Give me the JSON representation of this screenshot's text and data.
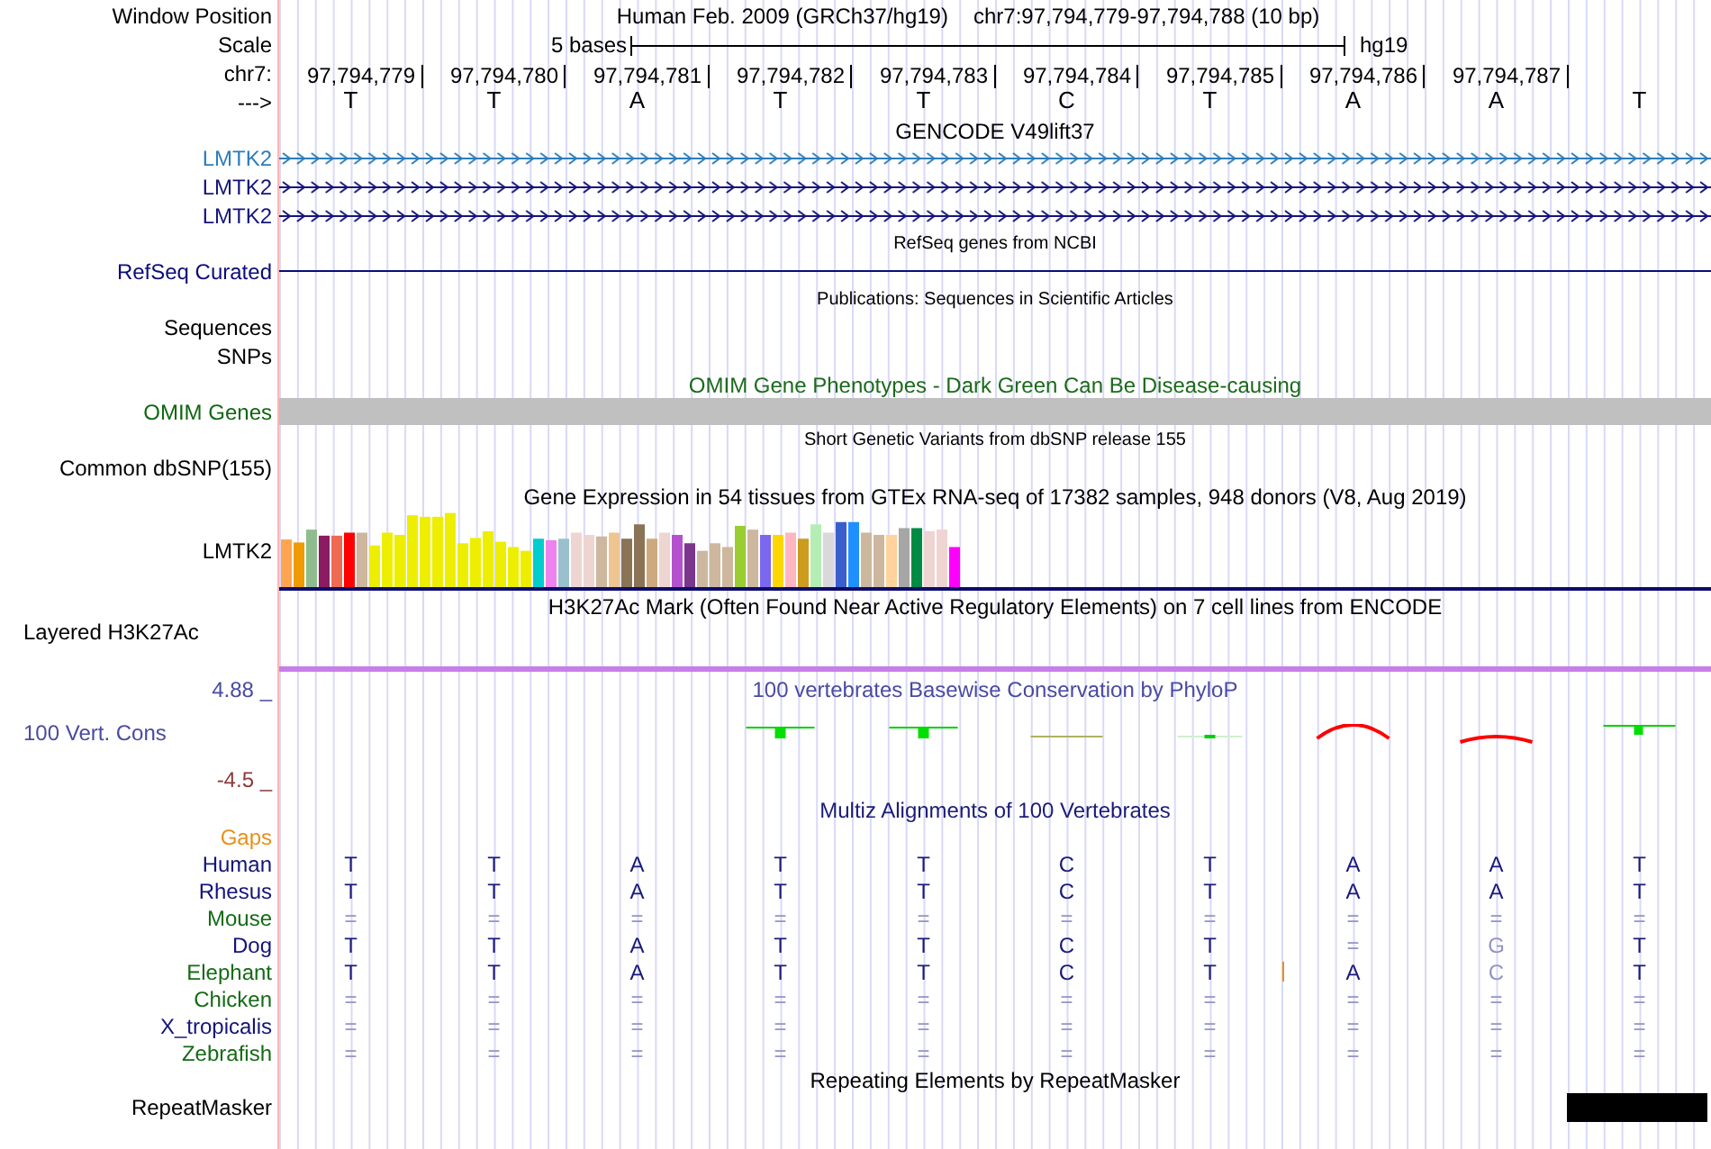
{
  "header": {
    "label": "Window Position",
    "title": "Human Feb. 2009 (GRCh37/hg19)",
    "position": "chr7:97,794,779-97,794,788 (10 bp)"
  },
  "scale": {
    "label": "Scale",
    "span": "5 bases",
    "assembly": "hg19"
  },
  "ruler": {
    "label": "chr7:",
    "positions": [
      "97,794,779",
      "97,794,780",
      "97,794,781",
      "97,794,782",
      "97,794,783",
      "97,794,784",
      "97,794,785",
      "97,794,786",
      "97,794,787"
    ]
  },
  "strand": {
    "label": "--->",
    "bases": [
      "T",
      "T",
      "A",
      "T",
      "T",
      "C",
      "T",
      "A",
      "A",
      "T"
    ]
  },
  "tracks": [
    {
      "kind": "title",
      "text": "GENCODE V49lift37",
      "color": "#000000"
    },
    {
      "kind": "gene",
      "label": "LMTK2",
      "color": "#2c7dbd"
    },
    {
      "kind": "gene",
      "label": "LMTK2",
      "color": "#14147a"
    },
    {
      "kind": "gene",
      "label": "LMTK2",
      "color": "#14147a"
    },
    {
      "kind": "small_title",
      "text": "RefSeq genes from NCBI",
      "color": "#000000"
    },
    {
      "kind": "line",
      "label": "RefSeq Curated",
      "color": "#0c0c78"
    },
    {
      "kind": "small_title",
      "text": "Publications: Sequences in Scientific Articles",
      "color": "#000000"
    },
    {
      "kind": "empty",
      "label": "Sequences",
      "color": "#000000"
    },
    {
      "kind": "empty",
      "label": "SNPs",
      "color": "#000000"
    },
    {
      "kind": "title",
      "text": "OMIM Gene Phenotypes - Dark Green Can Be Disease-causing",
      "color": "#1b6a1b"
    },
    {
      "kind": "bar",
      "label": "OMIM Genes",
      "color": "#0f660f"
    },
    {
      "kind": "small_title",
      "text": "Short Genetic Variants from dbSNP release 155",
      "color": "#000000"
    },
    {
      "kind": "empty",
      "label": "Common dbSNP(155)",
      "color": "#000000"
    },
    {
      "kind": "title",
      "text": "Gene Expression in 54 tissues from GTEx RNA-seq of 17382 samples, 948 donors (V8, Aug 2019)",
      "color": "#000000"
    },
    {
      "kind": "expression",
      "label": "LMTK2",
      "color": "#000000"
    },
    {
      "kind": "title",
      "text": "H3K27Ac Mark (Often Found Near Active Regulatory Elements) on 7 cell lines from ENCODE",
      "color": "#000000"
    },
    {
      "kind": "layered",
      "label": "Layered H3K27Ac",
      "color": "#000000"
    },
    {
      "kind": "conservation",
      "title": "100 vertebrates Basewise Conservation by PhyloP",
      "label": "100 Vert. Cons",
      "max": "4.88 _",
      "min": "-4.5 _",
      "color": "#4a4aa0"
    },
    {
      "kind": "title",
      "text": "Multiz Alignments of 100 Vertebrates",
      "color": "#1b1b78"
    },
    {
      "kind": "alignment",
      "rows": [
        {
          "label": "Gaps",
          "color": "#e8901c"
        },
        {
          "label": "Human",
          "color": "#14147a",
          "bases": [
            "T",
            "T",
            "A",
            "T",
            "T",
            "C",
            "T",
            "A",
            "A",
            "T"
          ],
          "faded": [
            false,
            false,
            false,
            false,
            false,
            false,
            false,
            false,
            false,
            false
          ],
          "insertion": false
        },
        {
          "label": "Rhesus",
          "color": "#14147a",
          "bases": [
            "T",
            "T",
            "A",
            "T",
            "T",
            "C",
            "T",
            "A",
            "A",
            "T"
          ],
          "faded": [
            false,
            false,
            false,
            false,
            false,
            false,
            false,
            false,
            false,
            false
          ],
          "insertion": false
        },
        {
          "label": "Mouse",
          "color": "#156b15",
          "bases": [
            "=",
            "=",
            "=",
            "=",
            "=",
            "=",
            "=",
            "=",
            "=",
            "="
          ],
          "faded": [
            true,
            true,
            true,
            true,
            true,
            true,
            true,
            true,
            true,
            true
          ],
          "insertion": false
        },
        {
          "label": "Dog",
          "color": "#14147a",
          "bases": [
            "T",
            "T",
            "A",
            "T",
            "T",
            "C",
            "T",
            "=",
            "G",
            "T"
          ],
          "faded": [
            false,
            false,
            false,
            false,
            false,
            false,
            false,
            true,
            true,
            false
          ],
          "insertion": false
        },
        {
          "label": "Elephant",
          "color": "#156b15",
          "bases": [
            "T",
            "T",
            "A",
            "T",
            "T",
            "C",
            "T",
            "A",
            "C",
            "T"
          ],
          "faded": [
            false,
            false,
            false,
            false,
            false,
            false,
            false,
            false,
            true,
            false
          ],
          "insertion": true
        },
        {
          "label": "Chicken",
          "color": "#156b15",
          "bases": [
            "=",
            "=",
            "=",
            "=",
            "=",
            "=",
            "=",
            "=",
            "=",
            "="
          ],
          "faded": [
            true,
            true,
            true,
            true,
            true,
            true,
            true,
            true,
            true,
            true
          ],
          "insertion": false
        },
        {
          "label": "X_tropicalis",
          "color": "#14147a",
          "bases": [
            "=",
            "=",
            "=",
            "=",
            "=",
            "=",
            "=",
            "=",
            "=",
            "="
          ],
          "faded": [
            true,
            true,
            true,
            true,
            true,
            true,
            true,
            true,
            true,
            true
          ],
          "insertion": false
        },
        {
          "label": "Zebrafish",
          "color": "#156b15",
          "bases": [
            "=",
            "=",
            "=",
            "=",
            "=",
            "=",
            "=",
            "=",
            "=",
            "="
          ],
          "faded": [
            true,
            true,
            true,
            true,
            true,
            true,
            true,
            true,
            true,
            true
          ],
          "insertion": false
        }
      ]
    },
    {
      "kind": "title",
      "text": "Repeating Elements by RepeatMasker",
      "color": "#000000"
    },
    {
      "kind": "repeat",
      "label": "RepeatMasker",
      "color": "#000000"
    }
  ]
}
